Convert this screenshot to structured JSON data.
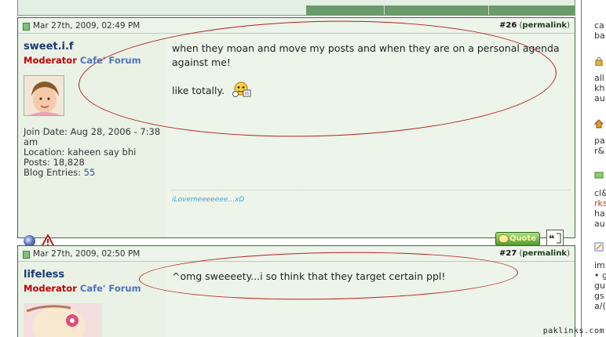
{
  "posts": [
    {
      "date": "Mar 27th, 2009, 02:49 PM",
      "number": "#26",
      "permalink": "permalink",
      "username": "sweet.i.f",
      "title_role": "Moderator",
      "title_forum": "Cafe' Forum",
      "join_date": "Join Date: Aug 28, 2006 - 7:38 am",
      "location": "Location: kaheen say bhi",
      "posts": "Posts: 18,828",
      "blog_label": "Blog Entries:",
      "blog_count": "55",
      "message_line1": "when they moan and move my posts and when they are on a personal agenda against me!",
      "message_line2": "like totally.",
      "signature": "iLovemeeeeeee...xD",
      "quote_label": "Quote"
    },
    {
      "date": "Mar 27th, 2009, 02:50 PM",
      "number": "#27",
      "permalink": "permalink",
      "username": "lifeless",
      "title_role": "Moderator",
      "title_forum": "Cafe' Forum",
      "message_line1": "^omg sweeeety...i so think that they target certain ppl!"
    }
  ],
  "sidebar": {
    "lines": [
      "ca",
      "ba",
      "all",
      "kh",
      "au",
      "pa",
      "r&",
      "cl&",
      "rks",
      "ha",
      "au",
      "im",
      "• g",
      "gu",
      "gs",
      "a/("
    ]
  },
  "watermark": "paklinks.com",
  "colors": {
    "post_border": "#3f6a3f",
    "post_bg": "#eaf2e6",
    "username": "#1c3a73",
    "moderator": "#c00000",
    "forum": "#4f73b8",
    "annotation_ellipse": "#b3201f"
  }
}
